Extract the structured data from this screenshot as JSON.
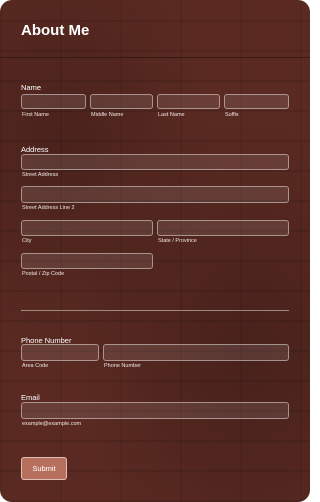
{
  "form": {
    "title": "About Me",
    "submit_label": "Submit"
  },
  "name": {
    "label": "Name",
    "first": "First Name",
    "middle": "Middle Name",
    "last": "Last Name",
    "suffix": "Suffix"
  },
  "address": {
    "label": "Address",
    "street": "Street Address",
    "street2": "Street Address Line 2",
    "city": "City",
    "state": "State / Province",
    "postal": "Postal / Zip Code"
  },
  "phone": {
    "label": "Phone Number",
    "area_code": "Area Code",
    "number": "Phone Number"
  },
  "email": {
    "label": "Email",
    "hint": "example@example.com"
  },
  "colors": {
    "background": "#5a2a22",
    "button": "#b7705e",
    "text": "#ffffff"
  }
}
